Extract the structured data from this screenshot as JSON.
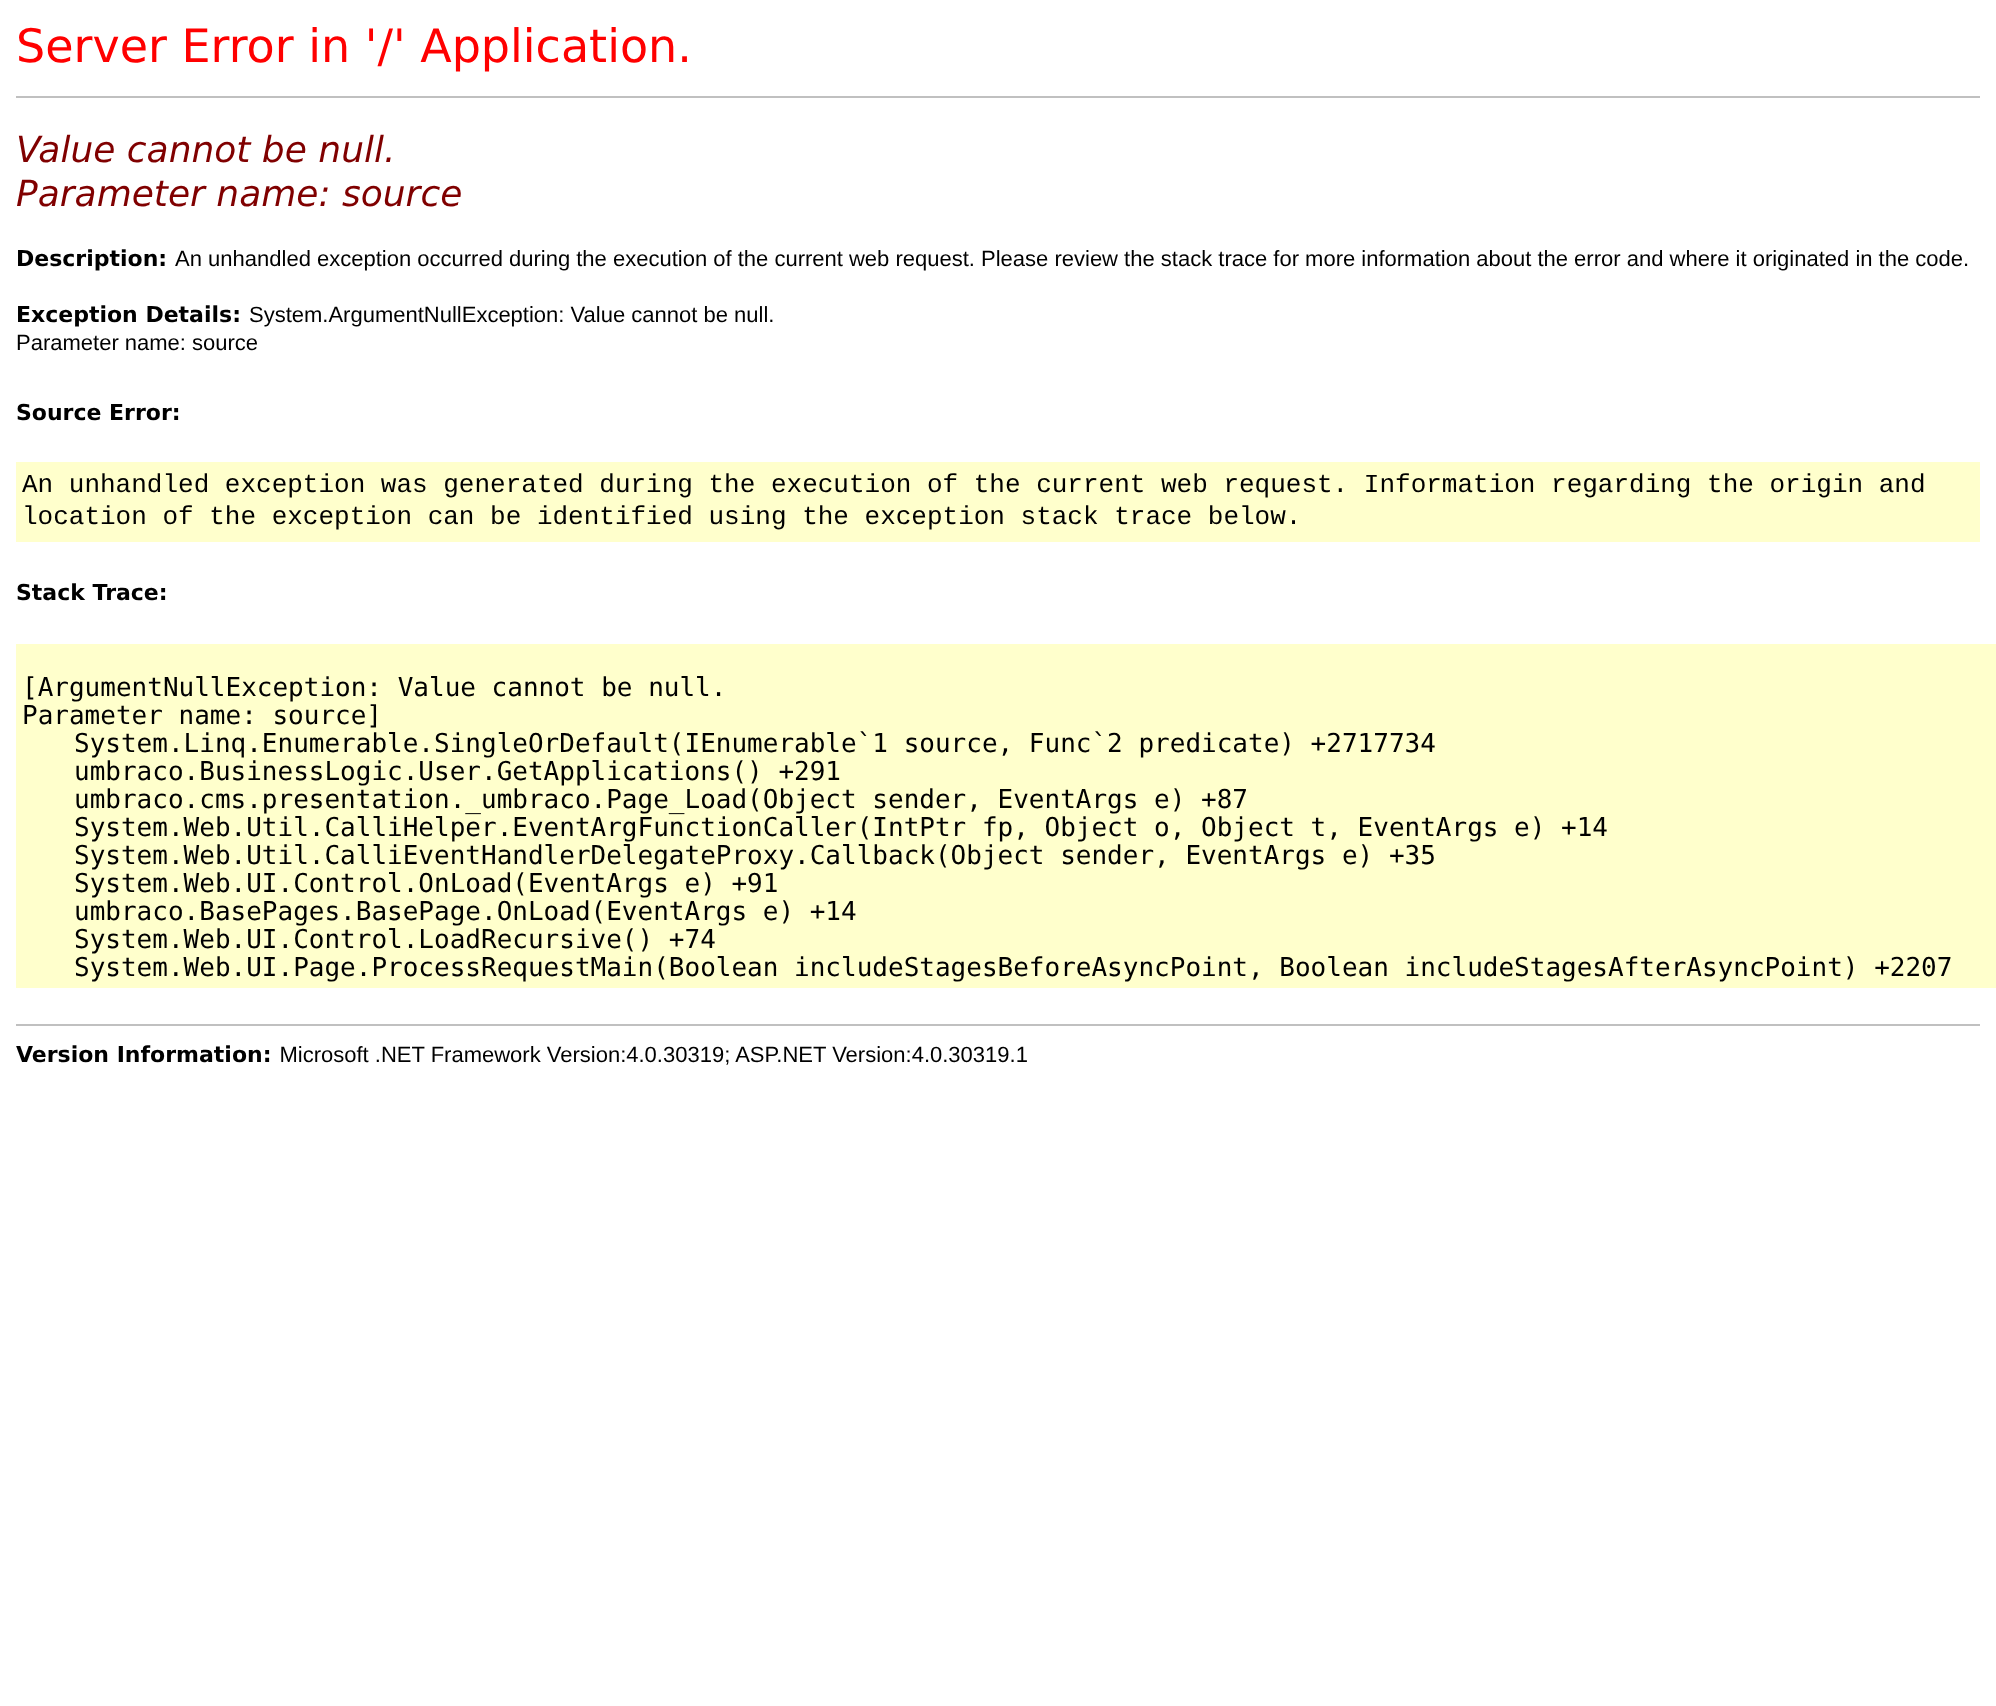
{
  "title": "Server Error in '/' Application.",
  "heading": [
    "Value cannot be null.",
    "Parameter name: source"
  ],
  "description": {
    "label": "Description:",
    "text": "An unhandled exception occurred during the execution of the current web request. Please review the stack trace for more information about the error and where it originated in the code."
  },
  "exception_details": {
    "label": "Exception Details:",
    "lines": [
      "System.ArgumentNullException: Value cannot be null.",
      "Parameter name: source"
    ]
  },
  "source_error": {
    "label": "Source Error:",
    "text": "An unhandled exception was generated during the execution of the current web request. Information regarding the origin and location of the exception can be identified using the exception stack trace below."
  },
  "stack_trace": {
    "label": "Stack Trace:",
    "message": [
      "[ArgumentNullException: Value cannot be null.",
      "Parameter name: source]"
    ],
    "frames": [
      "System.Linq.Enumerable.SingleOrDefault(IEnumerable`1 source, Func`2 predicate) +2717734",
      "umbraco.BusinessLogic.User.GetApplications() +291",
      "umbraco.cms.presentation._umbraco.Page_Load(Object sender, EventArgs e) +87",
      "System.Web.Util.CalliHelper.EventArgFunctionCaller(IntPtr fp, Object o, Object t, EventArgs e) +14",
      "System.Web.Util.CalliEventHandlerDelegateProxy.Callback(Object sender, EventArgs e) +35",
      "System.Web.UI.Control.OnLoad(EventArgs e) +91",
      "umbraco.BasePages.BasePage.OnLoad(EventArgs e) +14",
      "System.Web.UI.Control.LoadRecursive() +74",
      "System.Web.UI.Page.ProcessRequestMain(Boolean includeStagesBeforeAsyncPoint, Boolean includeStagesAfterAsyncPoint) +2207"
    ]
  },
  "version_information": {
    "label": "Version Information:",
    "text": "Microsoft .NET Framework Version:4.0.30319; ASP.NET Version:4.0.30319.1"
  }
}
